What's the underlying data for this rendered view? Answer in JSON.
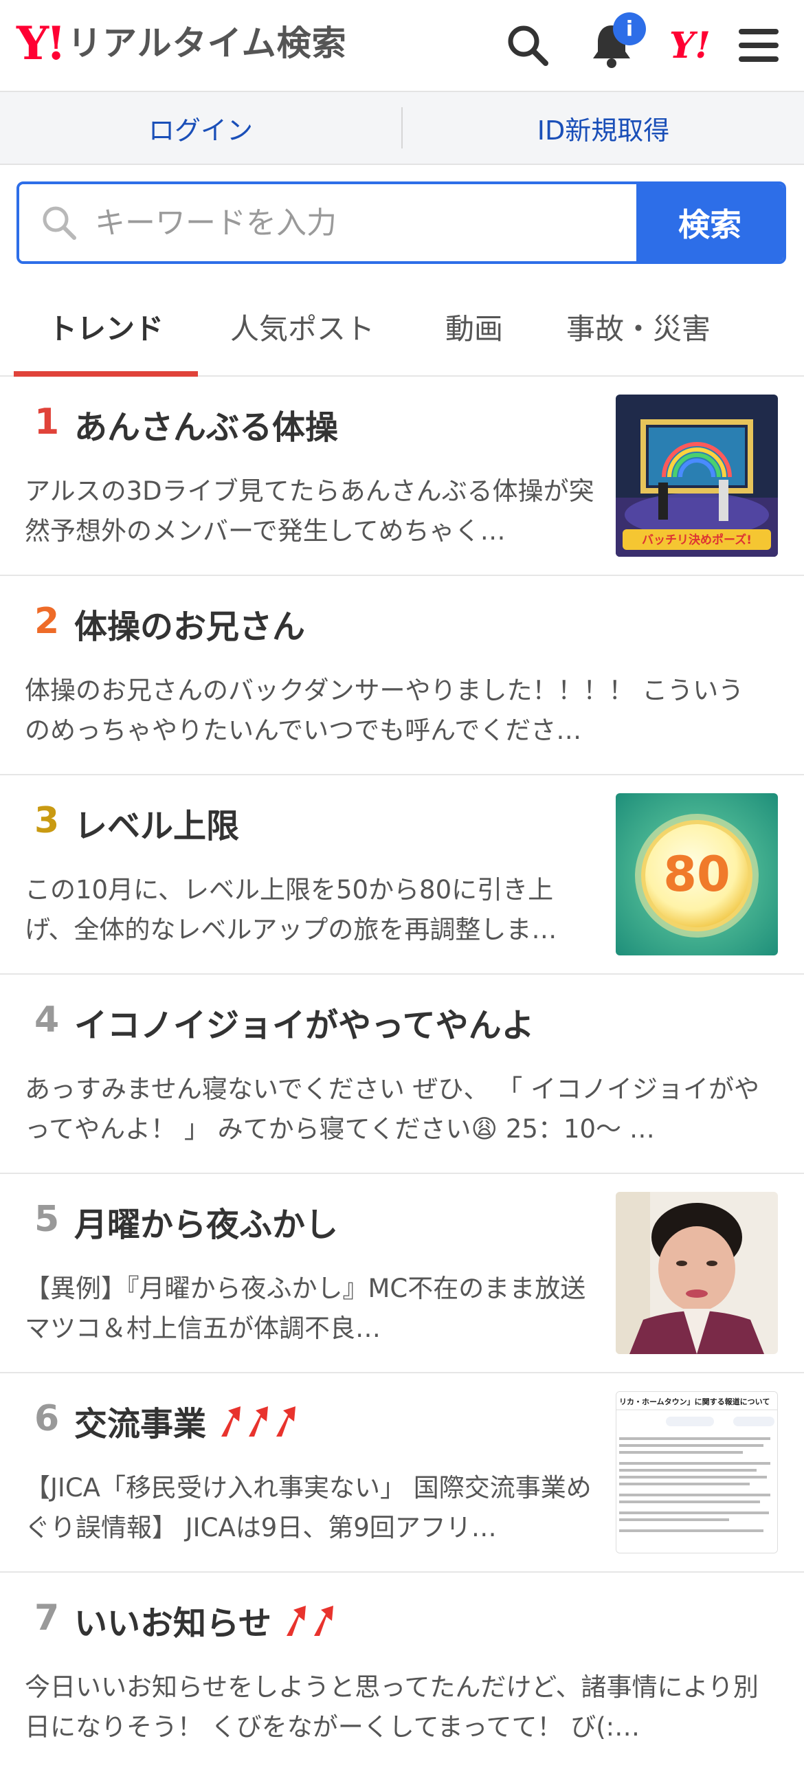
{
  "header": {
    "logo_mark": "Y!",
    "logo_text": "リアルタイム検索",
    "notification_badge": "i",
    "yahoo_mark": "Y!"
  },
  "auth": {
    "login": "ログイン",
    "register": "ID新規取得"
  },
  "search": {
    "placeholder": "キーワードを入力",
    "button": "検索"
  },
  "tabs": [
    {
      "label": "トレンド",
      "active": true
    },
    {
      "label": "人気ポスト"
    },
    {
      "label": "動画"
    },
    {
      "label": "事故・災害"
    }
  ],
  "trends": [
    {
      "rank": "1",
      "title": "あんさんぶる体操",
      "desc": "アルスの3Dライブ見てたらあんさんぶる体操が突然予想外のメンバーで発生してめちゃく…",
      "thumb": "stage-image",
      "thumb_text": "バッチリ決めポーズ!"
    },
    {
      "rank": "2",
      "title": "体操のお兄さん",
      "desc": "体操のお兄さんのバックダンサーやりました！！！！ こういうのめっちゃやりたいんでいつでも呼んでくださ…"
    },
    {
      "rank": "3",
      "title": "レベル上限",
      "desc": "この10月に、レベル上限を50から80に引き上げ、全体的なレベルアップの旅を再調整しま…",
      "thumb": "level-image",
      "thumb_text": "80"
    },
    {
      "rank": "4",
      "title": "イコノイジョイがやってやんよ",
      "desc": "あっすみません寝ないでください ぜひ、 「 イコノイジョイがやってやんよ！ 」 みてから寝てください😩 25：10〜 …"
    },
    {
      "rank": "5",
      "title": "月曜から夜ふかし",
      "desc": "【異例】『月曜から夜ふかし』MC不在のまま放送 マツコ＆村上信五が体調不良…",
      "thumb": "person-image"
    },
    {
      "rank": "6",
      "title": "交流事業",
      "desc": "【JICA「移民受け入れ事実ない」 国際交流事業めぐり誤情報】 JICAは9日、第9回アフリ…",
      "thumb": "document-image",
      "thumb_text": "リカ・ホームタウン」に関する報道について",
      "arrows": 3
    },
    {
      "rank": "7",
      "title": "いいお知らせ",
      "desc": "今日いいお知らせをしようと思ってたんだけど、諸事情により別日になりそう！ くびをながーくしてまってて！ び(:…",
      "arrows": 2
    }
  ],
  "colors": {
    "brand_red": "#ff0033",
    "accent_blue": "#2d6ee8",
    "link_blue": "#1a4fb8",
    "rank1": "#e0433a",
    "rank2": "#ee6b28",
    "rank3": "#c99a12",
    "rank_other": "#999999",
    "tab_underline": "#e0433a",
    "arrow_red": "#e8332d"
  }
}
